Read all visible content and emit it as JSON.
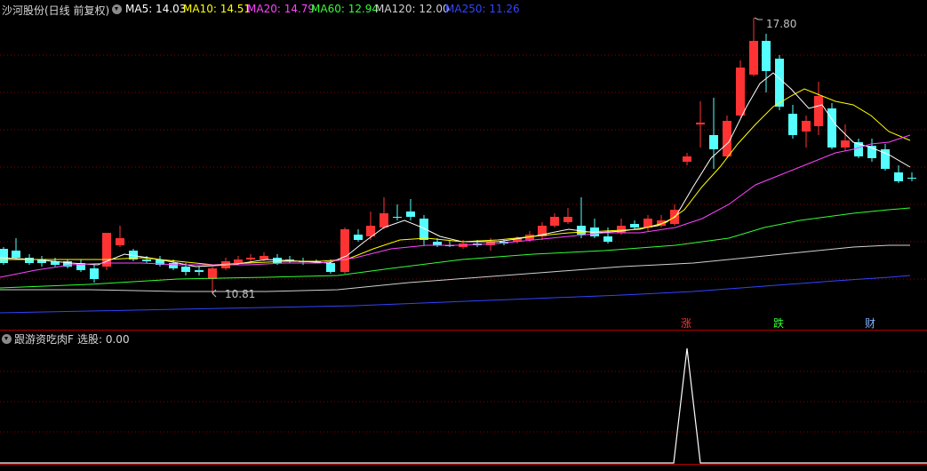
{
  "header": {
    "title": "沙河股份(日线 前复权)",
    "ma_labels": [
      {
        "text": "MA5: 14.03",
        "color": "#ffffff"
      },
      {
        "text": "MA10: 14.51",
        "color": "#ffff00"
      },
      {
        "text": "MA20: 14.79",
        "color": "#ff44ff"
      },
      {
        "text": "MA60: 12.94",
        "color": "#33ff33"
      },
      {
        "text": "MA120: 12.00",
        "color": "#d0d0d0"
      },
      {
        "text": "MA250: 11.26",
        "color": "#3344ff"
      }
    ]
  },
  "main_chart": {
    "high_label": "17.80",
    "low_label": "10.81",
    "colors": {
      "up": "#ff3333",
      "down": "#55ffff",
      "grid": "#8b0000"
    }
  },
  "badges": {
    "zhang": "涨",
    "die": "跌",
    "cai": "财"
  },
  "sub_chart": {
    "title": "跟游资吃肉F",
    "select_label": "选股: 0.00"
  },
  "colors": {
    "accent_red": "#ff3333",
    "cyan": "#55ffff"
  }
}
